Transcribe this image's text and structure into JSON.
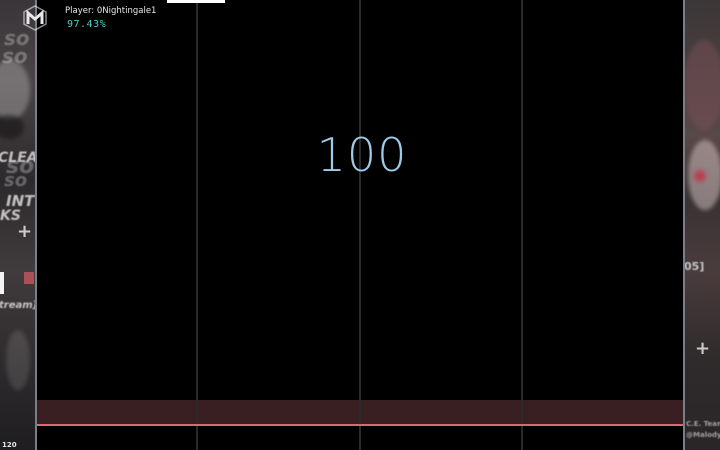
{
  "hud": {
    "player_label": "Player: 0Nightingale1",
    "accuracy": "97.43%",
    "combo": "100",
    "fps": "120",
    "accent_color": "#4fd1c5",
    "combo_color": "#9fcbe8",
    "judge_line_color": "#d96a72"
  },
  "background_left": {
    "words": [
      "so",
      "so",
      "so",
      "CLEAR",
      "so",
      "INT",
      "KS",
      "tream]"
    ]
  },
  "background_right": {
    "words": [
      "05]",
      "C.E. Team",
      "@Malody"
    ]
  },
  "progress": 0.09
}
